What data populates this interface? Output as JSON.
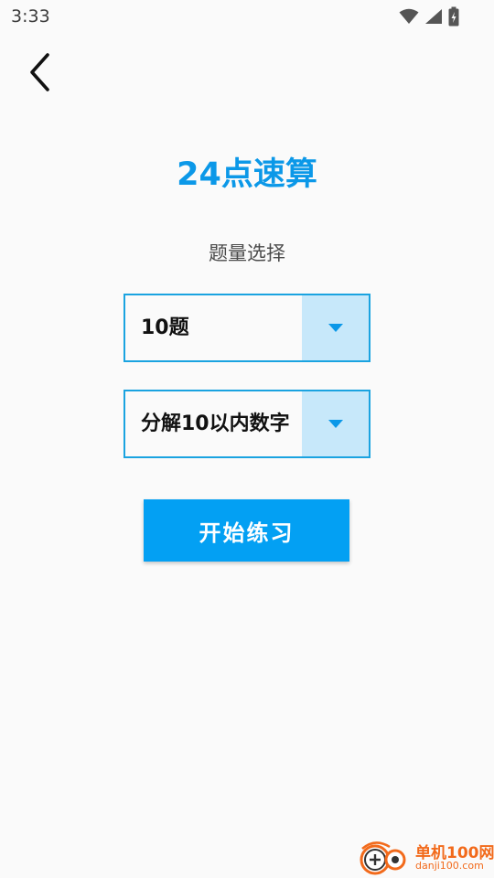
{
  "status_bar": {
    "time": "3:33",
    "icons": [
      "wifi-icon",
      "cell-signal-icon",
      "battery-charging-icon"
    ]
  },
  "nav": {
    "back_icon": "chevron-left-icon"
  },
  "title": "24点速算",
  "section_label": "题量选择",
  "dropdowns": [
    {
      "value": "10题",
      "icon": "triangle-down-icon"
    },
    {
      "value": "分解10以内数字",
      "icon": "triangle-down-icon"
    }
  ],
  "start_button": "开始练习",
  "watermark": {
    "name": "单机100网",
    "url": "danji100.com"
  },
  "colors": {
    "accent": "#0b98e8",
    "button": "#03a0f3",
    "dropdown_border": "#1aa3e0",
    "dropdown_arrow_bg": "#c7e8fa",
    "watermark": "#f26a1b"
  }
}
